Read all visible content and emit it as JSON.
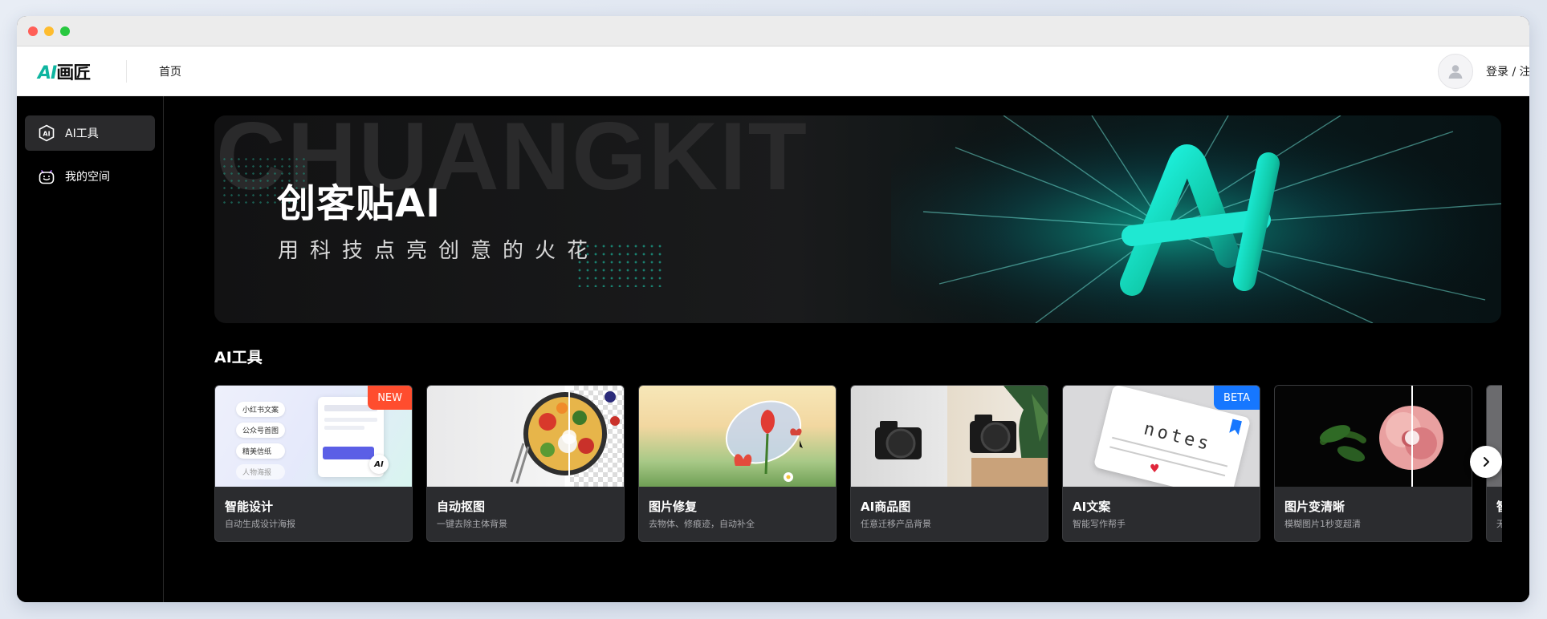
{
  "header": {
    "logo_ai": "AI",
    "logo_rest": "画匠",
    "nav_home": "首页",
    "login": "登录 / 注册"
  },
  "sidebar": {
    "items": [
      {
        "label": "AI工具",
        "icon": "ai-hex-icon",
        "active": true
      },
      {
        "label": "我的空间",
        "icon": "robot-face-icon",
        "active": false
      }
    ]
  },
  "banner": {
    "watermark": "CHUANGKIT",
    "title": "创客贴AI",
    "subtitle": "用科技点亮创意的火花",
    "art_text": "AI"
  },
  "section": {
    "title": "AI工具"
  },
  "cards": [
    {
      "name": "智能设计",
      "desc": "自动生成设计海报",
      "badge": "NEW",
      "badge_color": "#ff4d2e",
      "chips": [
        "小红书文案",
        "公众号首图",
        "精美信纸",
        "人物海报"
      ]
    },
    {
      "name": "自动抠图",
      "desc": "一键去除主体背景",
      "badge": "",
      "badge_color": ""
    },
    {
      "name": "图片修复",
      "desc": "去物体、修痕迹，自动补全",
      "badge": "",
      "badge_color": ""
    },
    {
      "name": "AI商品图",
      "desc": "任意迁移产品背景",
      "badge": "",
      "badge_color": ""
    },
    {
      "name": "AI文案",
      "desc": "智能写作帮手",
      "badge": "BETA",
      "badge_color": "#1677ff",
      "notes_text": "notes"
    },
    {
      "name": "图片变清晰",
      "desc": "模糊图片1秒变超清",
      "badge": "",
      "badge_color": ""
    },
    {
      "name": "智",
      "desc": "无",
      "badge": "",
      "badge_color": ""
    }
  ],
  "colors": {
    "accent": "#0fb5a0",
    "new_badge": "#ff4d2e",
    "beta_badge": "#1677ff"
  }
}
